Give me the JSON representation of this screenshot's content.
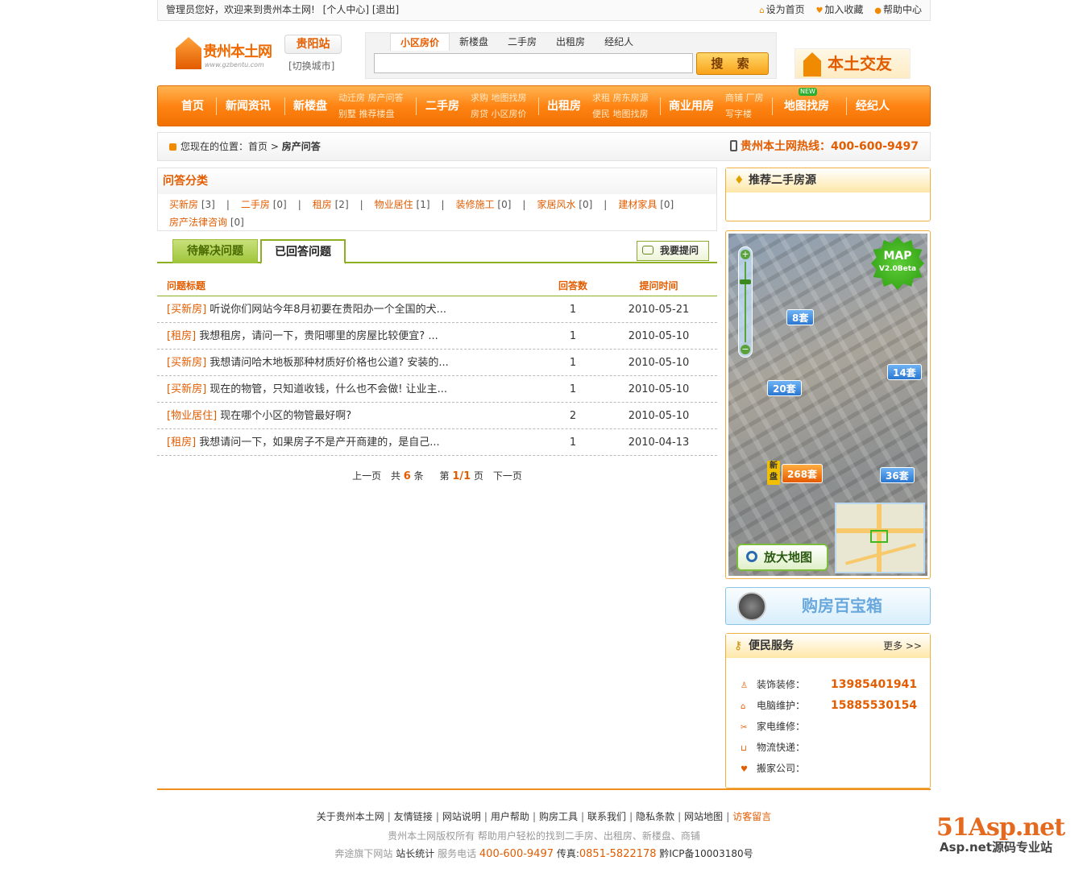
{
  "topbar": {
    "welcome": "管理员您好，欢迎来到贵州本土网!",
    "user_center": "[个人中心]",
    "logout": "[退出]",
    "set_home": "设为首页",
    "add_fav": "加入收藏",
    "help": "帮助中心"
  },
  "header": {
    "logo_name": "贵州本土网",
    "logo_url": "www.gzbentu.com",
    "station": "贵阳站",
    "switch_city": "[切换城市]",
    "search_tabs": [
      "小区房价",
      "新楼盘",
      "二手房",
      "出租房",
      "经纪人"
    ],
    "search_active": "小区房价",
    "search_value": "",
    "search_button": "搜 索",
    "bentu_banner": "本土交友"
  },
  "nav": {
    "home": "首页",
    "news": "新闻资讯",
    "new_houses": "新楼盘",
    "new_sub": [
      "动迁房",
      "房产问答",
      "别墅",
      "推荐楼盘"
    ],
    "second_hand": "二手房",
    "second_sub": [
      "求购",
      "地图找房",
      "房贷",
      "小区房价"
    ],
    "rent": "出租房",
    "rent_sub": [
      "求租",
      "房东房源",
      "便民",
      "地图找房"
    ],
    "commercial": "商业用房",
    "commercial_sub": [
      "商铺",
      "厂房",
      "写字楼"
    ],
    "map": "地图找房",
    "map_badge": "NEW",
    "agent": "经纪人"
  },
  "breadcrumb": {
    "prefix": "您现在的位置：",
    "home": "首页",
    "arrow": ">",
    "current": "房产问答",
    "hotline": "贵州本土网热线：400-600-9497"
  },
  "categories": {
    "title": "问答分类",
    "items": [
      {
        "name": "买新房",
        "count": "[3]"
      },
      {
        "name": "二手房",
        "count": "[0]"
      },
      {
        "name": "租房",
        "count": "[2]"
      },
      {
        "name": "物业居住",
        "count": "[1]"
      },
      {
        "name": "装修施工",
        "count": "[0]"
      },
      {
        "name": "家居风水",
        "count": "[0]"
      },
      {
        "name": "建材家具",
        "count": "[0]"
      },
      {
        "name": "房产法律咨询",
        "count": "[0]"
      }
    ],
    "separator": "|"
  },
  "tabs": {
    "pending": "待解决问题",
    "answered": "已回答问题",
    "ask": "我要提问"
  },
  "table": {
    "headers": [
      "问题标题",
      "回答数",
      "提问时间"
    ],
    "rows": [
      {
        "cat": "[买新房]",
        "title": "听说你们网站今年8月初要在贵阳办一个全国的犬...",
        "answers": "1",
        "date": "2010-05-21"
      },
      {
        "cat": "[租房]",
        "title": "我想租房，请问一下，贵阳哪里的房屋比较便宜? ...",
        "answers": "1",
        "date": "2010-05-10"
      },
      {
        "cat": "[买新房]",
        "title": "我想请问哈木地板那种材质好价格也公道? 安装的...",
        "answers": "1",
        "date": "2010-05-10"
      },
      {
        "cat": "[买新房]",
        "title": "现在的物管，只知道收钱，什么也不会做! 让业主...",
        "answers": "1",
        "date": "2010-05-10"
      },
      {
        "cat": "[物业居住]",
        "title": "现在哪个小区的物管最好啊?",
        "answers": "2",
        "date": "2010-05-10"
      },
      {
        "cat": "[租房]",
        "title": "我想请问一下，如果房子不是产开商建的，是自己...",
        "answers": "1",
        "date": "2010-04-13"
      }
    ]
  },
  "pager": {
    "prev": "上一页",
    "total_pre": "共",
    "total": "6",
    "total_post": "条",
    "page_pre": "第",
    "page": "1/1",
    "page_post": "页",
    "next": "下一页"
  },
  "sidebar": {
    "recommend_title": "推荐二手房源",
    "map": {
      "badge_line1": "MAP",
      "badge_line2": "V2.0Beta",
      "tags": [
        {
          "label": "8套"
        },
        {
          "label": "14套"
        },
        {
          "label": "20套"
        },
        {
          "label": "268套"
        },
        {
          "label": "36套"
        }
      ],
      "side_label": "新盘",
      "enlarge": "放大地图"
    },
    "toolbox": "购房百宝箱",
    "service": {
      "title": "便民服务",
      "more": "更多 >>",
      "items": [
        {
          "label": "装饰装修：",
          "value": "13985401941",
          "icon": "person-icon"
        },
        {
          "label": "电脑维护：",
          "value": "15885530154",
          "icon": "home-icon"
        },
        {
          "label": "家电维修：",
          "value": "",
          "icon": "tool-icon"
        },
        {
          "label": "物流快递：",
          "value": "",
          "icon": "cart-icon"
        },
        {
          "label": "搬家公司：",
          "value": "",
          "icon": "heart-icon"
        }
      ]
    }
  },
  "footer": {
    "links": [
      "关于贵州本土网",
      "友情链接",
      "网站说明",
      "用户帮助",
      "购房工具",
      "联系我们",
      "隐私条款",
      "网站地图",
      "访客留言"
    ],
    "copyright": "贵州本土网版权所有 帮助用户轻松的找到二手房、出租房、新楼盘、商铺",
    "brand": "奔途旗下网站",
    "stats": "站长统计",
    "service_label": "服务电话",
    "service_phone": "400-600-9497",
    "fax_label": "传真:",
    "fax": "0851-5822178",
    "icp": "黔ICP备10003180号"
  },
  "watermark": {
    "big": "51Asp.net",
    "small": "Asp.net源码专业站"
  },
  "colors": {
    "accent": "#e25c00",
    "nav_orange": "#ff8414",
    "tab_green": "#8cb021"
  }
}
